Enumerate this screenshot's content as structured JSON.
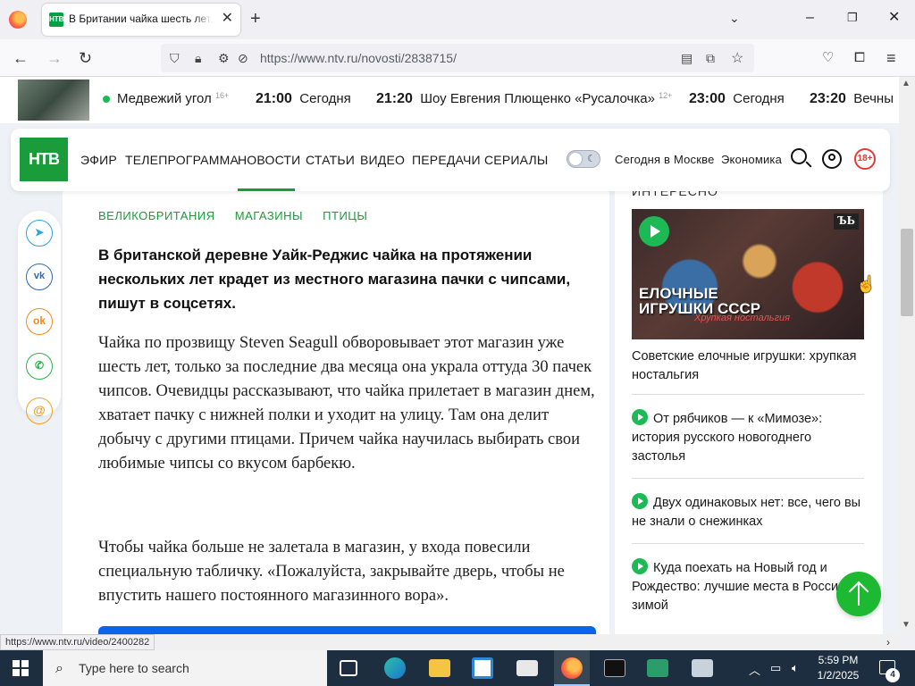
{
  "browser": {
    "tab_title": "В Британии чайка шесть лет ворует чипсы",
    "tab_favicon": "НТВ",
    "url": "https://www.ntv.ru/novosti/2838715/",
    "status_link": "https://www.ntv.ru/video/2400282"
  },
  "tv_schedule": [
    {
      "time": "",
      "title": "Медвежий угол",
      "age": "16+"
    },
    {
      "time": "21:00",
      "title": "Сегодня",
      "age": ""
    },
    {
      "time": "21:20",
      "title": "Шоу Евгения Плющенко «Русалочка»",
      "age": "12+"
    },
    {
      "time": "23:00",
      "title": "Сегодня",
      "age": ""
    },
    {
      "time": "23:20",
      "title": "Вечны",
      "age": ""
    }
  ],
  "nav": {
    "logo": "НТВ",
    "items": [
      "ЭФИР",
      "ТЕЛЕПРОГРАММА",
      "НОВОСТИ",
      "СТАТЬИ",
      "ВИДЕО",
      "ПЕРЕДАЧИ",
      "СЕРИАЛЫ"
    ],
    "active": "НОВОСТИ",
    "moscow": "Сегодня в Москве",
    "economy": "Экономика",
    "age": "18+"
  },
  "share": [
    "telegram",
    "vk",
    "ok",
    "whatsapp",
    "email"
  ],
  "article": {
    "tags": [
      "ВЕЛИКОБРИТАНИЯ",
      "МАГАЗИНЫ",
      "ПТИЦЫ"
    ],
    "lead": "В британской деревне Уайк-Реджис чайка на протяжении нескольких лет крадет из местного магазина пачки с чипсами, пишут в соцсетях.",
    "p1": "Чайка по прозвищу Steven Seagull обворовывает этот магазин уже шесть лет, только за последние два месяца она украла оттуда 30 пачек чипсов. Очевидцы рассказывают, что чайка прилетает в магазин днем, хватает пачку с нижней полки и уходит на улицу. Там она делит добычу с другими птицами. Причем чайка научилась выбирать свои любимые чипсы со вкусом барбекю.",
    "p2": "Чтобы чайка больше не залетала в магазин, у входа повесили специальную табличку. «Пожалуйста, закрывайте дверь, чтобы не впустить нашего постоянного магазинного вора»."
  },
  "sidebar": {
    "heading": "ИНТЕРЕСНО",
    "image_title": "ЕЛОЧНЫЕ ИГРУШКИ СССР",
    "image_sub": "Хрупкая ностальгия",
    "image_badge": "ЪЬ",
    "items": [
      "Советские елочные игрушки: хрупкая ностальгия",
      "От рябчиков — к «Мимозе»: история русского новогоднего застолья",
      "Двух одинаковых нет: все, чего вы не знали о снежинках",
      "Куда поехать на Новый год и Рождество: лучшие места в России зимой"
    ]
  },
  "taskbar": {
    "search_placeholder": "Type here to search",
    "time": "5:59 PM",
    "date": "1/2/2025",
    "notifications": "4"
  }
}
